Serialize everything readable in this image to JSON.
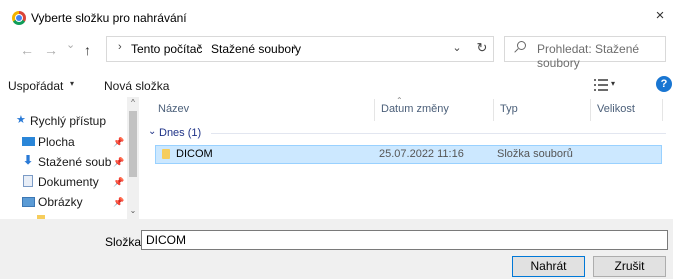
{
  "window": {
    "title": "Vyberte složku pro nahrávání",
    "close_glyph": "×"
  },
  "nav": {
    "back_glyph": "←",
    "forward_glyph": "→",
    "recent_glyph": "⌄",
    "up_glyph": "↑"
  },
  "address": {
    "separator": "›",
    "breadcrumbs": [
      "Tento počítač",
      "Stažené soubory"
    ],
    "dropdown_glyph": "⌄",
    "refresh_glyph": "↻"
  },
  "search": {
    "placeholder": "Prohledat: Stažené soubory"
  },
  "toolbar": {
    "organize_label": "Uspořádat",
    "new_folder_label": "Nová složka",
    "caret": "▾",
    "help_glyph": "?"
  },
  "sidebar": {
    "items": [
      {
        "label": "Rychlý přístup",
        "icon": "star-icon"
      },
      {
        "label": "Plocha",
        "icon": "desktop-icon",
        "pinned": true
      },
      {
        "label": "Stažené soub",
        "icon": "download-icon",
        "pinned": true
      },
      {
        "label": "Dokumenty",
        "icon": "document-icon",
        "pinned": true
      },
      {
        "label": "Obrázky",
        "icon": "pictures-icon",
        "pinned": true
      }
    ],
    "pin_glyph": "📌",
    "scroll_up_glyph": "^",
    "scroll_down_glyph": "⌄"
  },
  "file_list": {
    "columns": [
      "Název",
      "Datum změny",
      "Typ",
      "Velikost"
    ],
    "sort_glyph": "⌃",
    "group": {
      "label": "Dnes (1)",
      "caret": "⌄"
    },
    "rows": [
      {
        "name": "DICOM",
        "date": "25.07.2022 11:16",
        "type": "Složka souborů",
        "size": ""
      }
    ]
  },
  "footer": {
    "folder_label": "Složka:",
    "folder_value": "DICOM",
    "upload_label": "Nahrát",
    "cancel_label": "Zrušit"
  },
  "colors": {
    "accent": "#0078d7",
    "selection_bg": "#cce8ff",
    "selection_border": "#99d1ff",
    "folder": "#f6cd5c",
    "help": "#1976d2",
    "group_text": "#1e3287"
  }
}
